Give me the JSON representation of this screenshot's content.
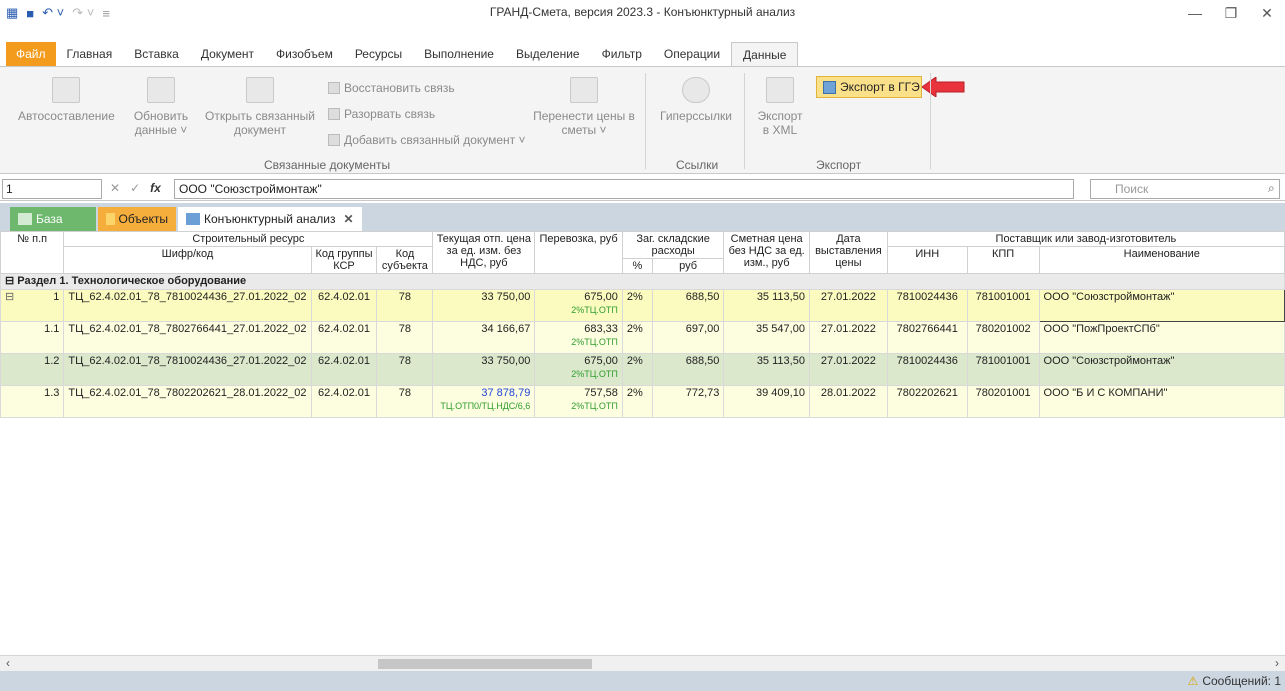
{
  "window": {
    "title": "ГРАНД-Смета, версия 2023.3 - Конъюнктурный анализ"
  },
  "menu_tabs": [
    {
      "label": "Файл"
    },
    {
      "label": "Главная"
    },
    {
      "label": "Вставка"
    },
    {
      "label": "Документ"
    },
    {
      "label": "Физобъем"
    },
    {
      "label": "Ресурсы"
    },
    {
      "label": "Выполнение"
    },
    {
      "label": "Выделение"
    },
    {
      "label": "Фильтр"
    },
    {
      "label": "Операции"
    },
    {
      "label": "Данные"
    }
  ],
  "ribbon": {
    "autosostavlenie": "Автосоставление",
    "obnovit": "Обновить данные ˅",
    "open_linked": "Открыть связанный документ",
    "restore_link": "Восстановить связь",
    "break_link": "Разорвать связь",
    "add_linked": "Добавить связанный документ ˅",
    "transfer_prices": "Перенести цены в сметы ˅",
    "hyperlinks": "Гиперссылки",
    "export_xml": "Экспорт в XML",
    "export_gge": "Экспорт в ГГЭ",
    "group_linked": "Связанные документы",
    "group_links": "Ссылки",
    "group_export": "Экспорт"
  },
  "formula_bar": {
    "cell": "1",
    "value": "ООО \"Союзстроймонтаж\"",
    "search_placeholder": "Поиск"
  },
  "doc_tabs": [
    {
      "label": "База"
    },
    {
      "label": "Объекты"
    },
    {
      "label": "Конъюнктурный анализ"
    }
  ],
  "table": {
    "headers": {
      "num": "№ п.п",
      "resource": "Строительный ресурс",
      "code": "Шифр/код",
      "ksr": "Код группы КСР",
      "subj": "Код субъекта",
      "price": "Текущая отп. цена за ед. изм. без НДС, руб",
      "transport": "Перевозка, руб",
      "storage": "Заг. складские расходы",
      "pct": "%",
      "rub": "руб",
      "estimate": "Сметная цена без НДС за ед. изм., руб",
      "date": "Дата выставления цены",
      "supplier": "Поставщик или завод-изготовитель",
      "inn": "ИНН",
      "kpp": "КПП",
      "name": "Наименование"
    },
    "section": "Раздел 1. Технологическое оборудование",
    "rows": [
      {
        "n": "1",
        "code": "ТЦ_62.4.02.01_78_7810024436_27.01.2022_02",
        "ksr": "62.4.02.01",
        "subj": "78",
        "price": "33 750,00",
        "price_note": "",
        "transport": "675,00",
        "transport_note": "2%ТЦ.ОТП",
        "pct": "2%",
        "rub": "688,50",
        "estimate": "35 113,50",
        "date": "27.01.2022",
        "inn": "7810024436",
        "kpp": "781001001",
        "name": "ООО \"Союзстроймонтаж\""
      },
      {
        "n": "1.1",
        "code": "ТЦ_62.4.02.01_78_7802766441_27.01.2022_02",
        "ksr": "62.4.02.01",
        "subj": "78",
        "price": "34 166,67",
        "price_note": "",
        "transport": "683,33",
        "transport_note": "2%ТЦ.ОТП",
        "pct": "2%",
        "rub": "697,00",
        "estimate": "35 547,00",
        "date": "27.01.2022",
        "inn": "7802766441",
        "kpp": "780201002",
        "name": "ООО \"ПожПроектСПб\""
      },
      {
        "n": "1.2",
        "code": "ТЦ_62.4.02.01_78_7810024436_27.01.2022_02",
        "ksr": "62.4.02.01",
        "subj": "78",
        "price": "33 750,00",
        "price_note": "",
        "transport": "675,00",
        "transport_note": "2%ТЦ.ОТП",
        "pct": "2%",
        "rub": "688,50",
        "estimate": "35 113,50",
        "date": "27.01.2022",
        "inn": "7810024436",
        "kpp": "781001001",
        "name": "ООО \"Союзстроймонтаж\""
      },
      {
        "n": "1.3",
        "code": "ТЦ_62.4.02.01_78_7802202621_28.01.2022_02",
        "ksr": "62.4.02.01",
        "subj": "78",
        "price": "37 878,79",
        "price_note": "ТЦ.ОТП0/ТЦ.НДС/6,6",
        "transport": "757,58",
        "transport_note": "2%ТЦ.ОТП",
        "pct": "2%",
        "rub": "772,73",
        "estimate": "39 409,10",
        "date": "28.01.2022",
        "inn": "7802202621",
        "kpp": "780201001",
        "name": "ООО \"Б И С КОМПАНИ\""
      }
    ]
  },
  "status": {
    "messages": "Сообщений: 1"
  },
  "colors": {
    "accent": "#f29b1d",
    "highlight": "#fbe08a",
    "arrow": "#e8323c"
  }
}
